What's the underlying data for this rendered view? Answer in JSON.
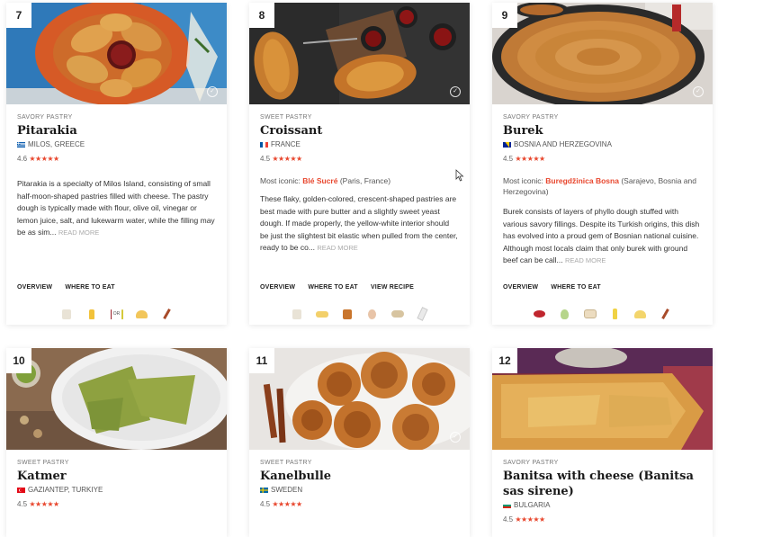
{
  "cards": [
    {
      "number": "7",
      "category": "SAVORY PASTRY",
      "title": "Pitarakia",
      "country": "MILOS, GREECE",
      "flag": "greece",
      "rating": "4.6",
      "stars": "★★★★★",
      "description": "Pitarakia is a specialty of Milos Island, consisting of small half-moon-shaped pastries filled with cheese. The pastry dough is typically made with flour, olive oil, vinegar or lemon juice, salt, and lukewarm water, while the filling may be as sim...",
      "read_more": "READ MORE",
      "links": [
        "OVERVIEW",
        "WHERE TO EAT"
      ],
      "or_label": "OR"
    },
    {
      "number": "8",
      "category": "SWEET PASTRY",
      "title": "Croissant",
      "country": "FRANCE",
      "flag": "france",
      "rating": "4.5",
      "stars": "★★★★★",
      "iconic_prefix": "Most iconic:",
      "iconic_place": "Blé Sucré",
      "iconic_suffix": "(Paris, France)",
      "description": "These flaky, golden-colored, crescent-shaped pastries are best made with pure butter and a slightly sweet yeast dough. If made properly, the yellow-white interior should be just the slightest bit elastic when pulled from the center, ready to be co...",
      "read_more": "READ MORE",
      "links": [
        "OVERVIEW",
        "WHERE TO EAT",
        "VIEW RECIPE"
      ]
    },
    {
      "number": "9",
      "category": "SAVORY PASTRY",
      "title": "Burek",
      "country": "BOSNIA AND HERZEGOVINA",
      "flag": "bosnia",
      "rating": "4.5",
      "stars": "★★★★★",
      "iconic_prefix": "Most iconic:",
      "iconic_place": "Buregdžinica Bosna",
      "iconic_suffix": "(Sarajevo, Bosnia and Herzegovina)",
      "description": "Burek consists of layers of phyllo dough stuffed with various savory fillings. Despite its Turkish origins, this dish has evolved into a proud gem of Bosnian national cuisine. Although most locals claim that only burek with ground beef can be call...",
      "read_more": "READ MORE",
      "links": [
        "OVERVIEW",
        "WHERE TO EAT"
      ]
    },
    {
      "number": "10",
      "category": "SWEET PASTRY",
      "title": "Katmer",
      "country": "GAZIANTEP, TURKIYE",
      "flag": "turkey",
      "rating": "4.5",
      "stars": "★★★★★"
    },
    {
      "number": "11",
      "category": "SWEET PASTRY",
      "title": "Kanelbulle",
      "country": "SWEDEN",
      "flag": "sweden",
      "rating": "4.5",
      "stars": "★★★★★"
    },
    {
      "number": "12",
      "category": "SAVORY PASTRY",
      "title": "Banitsa with cheese (Banitsa sas sirene)",
      "country": "BULGARIA",
      "flag": "bulgaria",
      "rating": "4.5",
      "stars": "★★★★★"
    }
  ],
  "ingredient_icons": {
    "card7": [
      "flour-bag-icon",
      "lemon-juice-icon",
      "vinegar-bottle-icon",
      "olive-oil-icon",
      "cheese-icon",
      "salt-shaker-icon"
    ],
    "card8": [
      "flour-bag-icon",
      "butter-icon",
      "sugar-icon",
      "egg-icon",
      "yeast-icon",
      "milk-icon"
    ],
    "card9": [
      "ground-beef-icon",
      "onion-icon",
      "phyllo-icon",
      "oil-bottle-icon",
      "cheese-icon",
      "pepper-icon"
    ]
  },
  "colors": {
    "accent": "#e8472e",
    "star": "#e8472e"
  }
}
